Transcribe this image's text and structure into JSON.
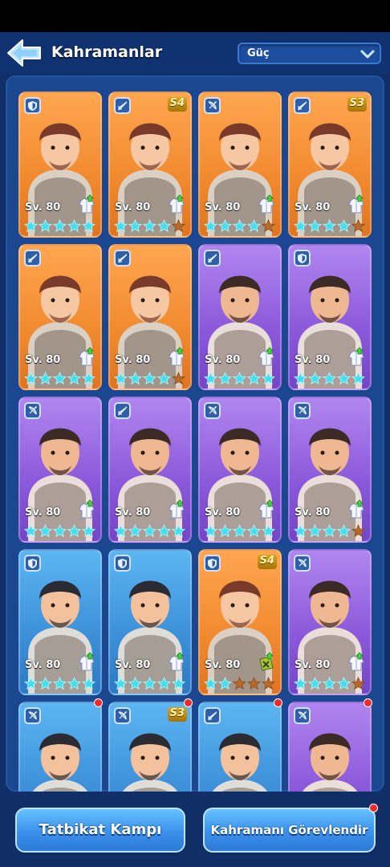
{
  "header": {
    "title": "Kahramanlar",
    "back_icon": "back-arrow-icon",
    "sort": {
      "selected": "Güç",
      "icon": "chevron-down-icon"
    }
  },
  "heroes": [
    {
      "level": "Sv. 80",
      "bg": "orange",
      "class": "shield",
      "badge": "",
      "filled_stars": 5,
      "upgrade": true,
      "equip": "armor",
      "new": false
    },
    {
      "level": "Sv. 80",
      "bg": "orange",
      "class": "sword",
      "badge": "S4",
      "filled_stars": 4,
      "upgrade": true,
      "equip": "armor",
      "new": false
    },
    {
      "level": "Sv. 80",
      "bg": "orange",
      "class": "bow",
      "badge": "",
      "filled_stars": 4,
      "upgrade": true,
      "equip": "armor",
      "new": false
    },
    {
      "level": "Sv. 80",
      "bg": "orange",
      "class": "sword",
      "badge": "S3",
      "filled_stars": 4,
      "upgrade": true,
      "equip": "armor",
      "new": false
    },
    {
      "level": "Sv. 80",
      "bg": "orange",
      "class": "sword",
      "badge": "",
      "filled_stars": 5,
      "upgrade": true,
      "equip": "armor",
      "new": false
    },
    {
      "level": "Sv. 80",
      "bg": "orange",
      "class": "sword",
      "badge": "",
      "filled_stars": 4,
      "upgrade": true,
      "equip": "armor",
      "new": false
    },
    {
      "level": "Sv. 80",
      "bg": "purple",
      "class": "sword",
      "badge": "",
      "filled_stars": 5,
      "upgrade": true,
      "equip": "armor",
      "new": false
    },
    {
      "level": "Sv. 80",
      "bg": "purple",
      "class": "shield",
      "badge": "",
      "filled_stars": 5,
      "upgrade": true,
      "equip": "armor",
      "new": false
    },
    {
      "level": "Sv. 80",
      "bg": "purple",
      "class": "bow",
      "badge": "",
      "filled_stars": 5,
      "upgrade": true,
      "equip": "armor",
      "new": false
    },
    {
      "level": "Sv. 80",
      "bg": "purple",
      "class": "sword",
      "badge": "",
      "filled_stars": 5,
      "upgrade": true,
      "equip": "armor",
      "new": false
    },
    {
      "level": "Sv. 80",
      "bg": "purple",
      "class": "bow",
      "badge": "",
      "filled_stars": 5,
      "upgrade": true,
      "equip": "armor",
      "new": false
    },
    {
      "level": "Sv. 80",
      "bg": "purple",
      "class": "bow",
      "badge": "",
      "filled_stars": 4,
      "upgrade": true,
      "equip": "armor",
      "new": false
    },
    {
      "level": "Sv. 80",
      "bg": "blue",
      "class": "shield",
      "badge": "",
      "filled_stars": 5,
      "upgrade": true,
      "equip": "armor",
      "new": false
    },
    {
      "level": "Sv. 80",
      "bg": "blue",
      "class": "shield",
      "badge": "",
      "filled_stars": 5,
      "upgrade": true,
      "equip": "armor",
      "new": false
    },
    {
      "level": "Sv. 80",
      "bg": "orange",
      "class": "shield",
      "badge": "S4",
      "filled_stars": 2,
      "upgrade": true,
      "equip": "scroll",
      "new": false
    },
    {
      "level": "Sv. 80",
      "bg": "purple",
      "class": "bow",
      "badge": "",
      "filled_stars": 4,
      "upgrade": true,
      "equip": "armor",
      "new": false
    },
    {
      "level": "",
      "bg": "blue",
      "class": "bow",
      "badge": "",
      "filled_stars": 0,
      "upgrade": false,
      "equip": "",
      "new": true
    },
    {
      "level": "",
      "bg": "blue",
      "class": "bow",
      "badge": "S3",
      "filled_stars": 0,
      "upgrade": false,
      "equip": "",
      "new": true
    },
    {
      "level": "",
      "bg": "blue",
      "class": "sword",
      "badge": "",
      "filled_stars": 0,
      "upgrade": false,
      "equip": "",
      "new": true
    },
    {
      "level": "",
      "bg": "purple",
      "class": "bow",
      "badge": "",
      "filled_stars": 0,
      "upgrade": false,
      "equip": "",
      "new": true
    }
  ],
  "footer": {
    "left_button": "Tatbikat Kampı",
    "right_button": "Kahramanı Görevlendir",
    "right_notification": true
  },
  "colors": {
    "orange_card": "#f18a2f",
    "purple_card": "#8a58da",
    "blue_card": "#3c8fd8",
    "star_cyan": "#3fe0f0",
    "upgrade_green": "#3ddc3a",
    "notification_red": "#f12a2a"
  }
}
